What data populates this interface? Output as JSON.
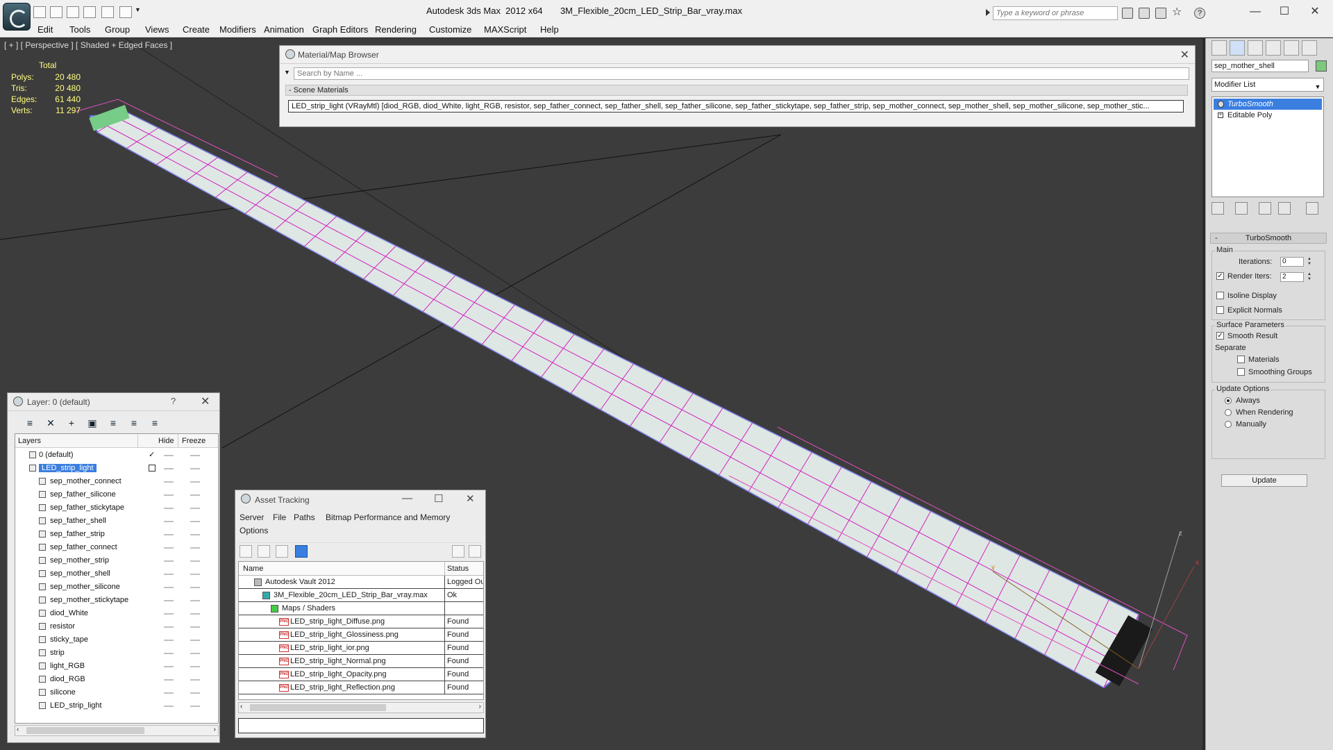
{
  "window": {
    "title": "Autodesk 3ds Max  2012 x64       3M_Flexible_20cm_LED_Strip_Bar_vray.max",
    "search_placeholder": "Type a keyword or phrase",
    "minimize": "—",
    "maximize": "☐",
    "close": "✕"
  },
  "menu": [
    "Edit",
    "Tools",
    "Group",
    "Views",
    "Create",
    "Modifiers",
    "Animation",
    "Graph Editors",
    "Rendering",
    "Customize",
    "MAXScript",
    "Help"
  ],
  "viewport": {
    "label": "[ + ] [ Perspective ] [ Shaded + Edged Faces ]",
    "stats_header": "Total",
    "stats": [
      {
        "label": "Polys:",
        "value": "20 480"
      },
      {
        "label": "Tris:",
        "value": "20 480"
      },
      {
        "label": "Edges:",
        "value": "61 440"
      },
      {
        "label": "Verts:",
        "value": "11 297"
      }
    ],
    "axis_labels": {
      "z": "z",
      "x": "x",
      "y": "y"
    }
  },
  "material_browser": {
    "title": "Material/Map Browser",
    "close": "✕",
    "search_placeholder": "Search by Name ...",
    "group_label": "- Scene Materials",
    "entry": "LED_strip_light (VRayMtl) [diod_RGB, diod_White, light_RGB, resistor, sep_father_connect, sep_father_shell, sep_father_silicone, sep_father_stickytape, sep_father_strip, sep_mother_connect, sep_mother_shell, sep_mother_silicone, sep_mother_stic..."
  },
  "command_panel": {
    "object_name": "sep_mother_shell",
    "modifier_list": "Modifier List",
    "stack": [
      "TurboSmooth",
      "Editable Poly"
    ],
    "rollout_title": "TurboSmooth",
    "main_label": "Main",
    "iterations_label": "Iterations:",
    "iterations_value": "0",
    "render_iters_label": "Render Iters:",
    "render_iters_value": "2",
    "isoline_label": "Isoline Display",
    "explicit_normals_label": "Explicit Normals",
    "surface_params_label": "Surface Parameters",
    "smooth_result_label": "Smooth Result",
    "separate_label": "Separate",
    "materials_label": "Materials",
    "smoothing_groups_label": "Smoothing Groups",
    "update_options_label": "Update Options",
    "always_label": "Always",
    "when_rendering_label": "When Rendering",
    "manually_label": "Manually",
    "update_button": "Update",
    "checked": {
      "render_iters": true,
      "isoline": false,
      "explicit_normals": false,
      "smooth_result": true,
      "materials": false,
      "smoothing_groups": false
    },
    "update_mode": "Always"
  },
  "layer_window": {
    "title": "Layer: 0 (default)",
    "help": "?",
    "close": "✕",
    "headers": {
      "layers": "Layers",
      "hide": "Hide",
      "freeze": "Freeze"
    },
    "rows": [
      {
        "name": "0 (default)",
        "kind": "layer",
        "current": true
      },
      {
        "name": "LED_strip_light",
        "kind": "layer",
        "selected": true
      },
      {
        "name": "sep_mother_connect",
        "kind": "object"
      },
      {
        "name": "sep_father_silicone",
        "kind": "object"
      },
      {
        "name": "sep_father_stickytape",
        "kind": "object"
      },
      {
        "name": "sep_father_shell",
        "kind": "object"
      },
      {
        "name": "sep_father_strip",
        "kind": "object"
      },
      {
        "name": "sep_father_connect",
        "kind": "object"
      },
      {
        "name": "sep_mother_strip",
        "kind": "object"
      },
      {
        "name": "sep_mother_shell",
        "kind": "object"
      },
      {
        "name": "sep_mother_silicone",
        "kind": "object"
      },
      {
        "name": "sep_mother_stickytape",
        "kind": "object"
      },
      {
        "name": "diod_White",
        "kind": "object"
      },
      {
        "name": "resistor",
        "kind": "object"
      },
      {
        "name": "sticky_tape",
        "kind": "object"
      },
      {
        "name": "strip",
        "kind": "object"
      },
      {
        "name": "light_RGB",
        "kind": "object"
      },
      {
        "name": "diod_RGB",
        "kind": "object"
      },
      {
        "name": "silicone",
        "kind": "object"
      },
      {
        "name": "LED_strip_light",
        "kind": "object"
      }
    ]
  },
  "asset_tracking": {
    "title": "Asset Tracking",
    "menu": [
      "Server",
      "File",
      "Paths",
      "Bitmap Performance and Memory",
      "Options"
    ],
    "headers": {
      "name": "Name",
      "status": "Status"
    },
    "rows": [
      {
        "name": "Autodesk Vault 2012",
        "status": "Logged Out",
        "level": 0,
        "icon": "vault"
      },
      {
        "name": "3M_Flexible_20cm_LED_Strip_Bar_vray.max",
        "status": "Ok",
        "level": 1,
        "icon": "max"
      },
      {
        "name": "Maps / Shaders",
        "status": "",
        "level": 2,
        "icon": "folder"
      },
      {
        "name": "LED_strip_light_Diffuse.png",
        "status": "Found",
        "level": 3,
        "icon": "png"
      },
      {
        "name": "LED_strip_light_Glossiness.png",
        "status": "Found",
        "level": 3,
        "icon": "png"
      },
      {
        "name": "LED_strip_light_ior.png",
        "status": "Found",
        "level": 3,
        "icon": "png"
      },
      {
        "name": "LED_strip_light_Normal.png",
        "status": "Found",
        "level": 3,
        "icon": "png"
      },
      {
        "name": "LED_strip_light_Opacity.png",
        "status": "Found",
        "level": 3,
        "icon": "png"
      },
      {
        "name": "LED_strip_light_Reflection.png",
        "status": "Found",
        "level": 3,
        "icon": "png"
      }
    ],
    "png_badge": "PNG"
  }
}
